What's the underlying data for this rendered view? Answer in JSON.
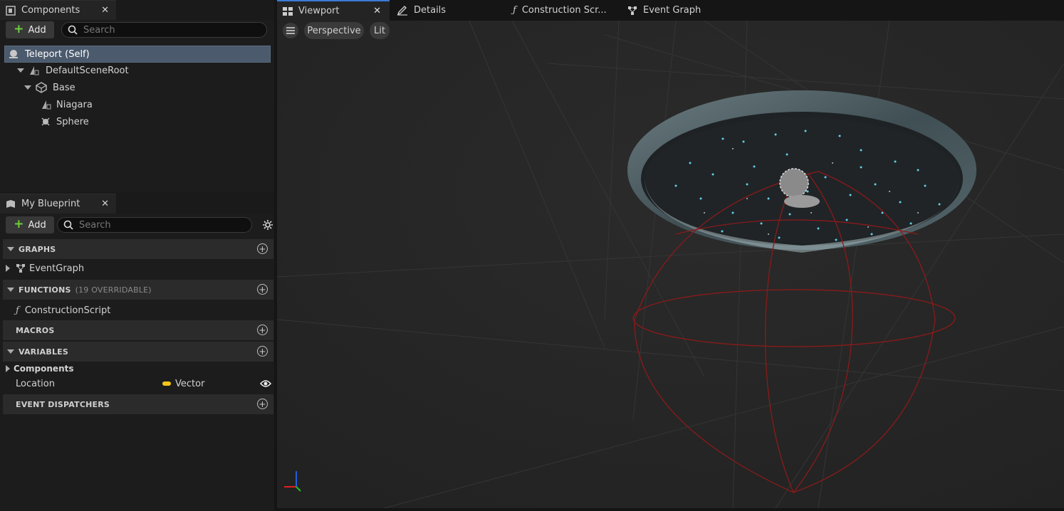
{
  "components_panel": {
    "tab_title": "Components",
    "add_label": "Add",
    "search_placeholder": "Search",
    "tree": [
      {
        "label": "Teleport (Self)"
      },
      {
        "label": "DefaultSceneRoot"
      },
      {
        "label": "Base"
      },
      {
        "label": "Niagara"
      },
      {
        "label": "Sphere"
      }
    ]
  },
  "blueprint_panel": {
    "tab_title": "My Blueprint",
    "add_label": "Add",
    "search_placeholder": "Search",
    "sections": {
      "graphs": "GRAPHS",
      "functions": "FUNCTIONS",
      "functions_sub": "(19 OVERRIDABLE)",
      "macros": "MACROS",
      "variables": "VARIABLES",
      "dispatchers": "EVENT DISPATCHERS"
    },
    "graphs_items": [
      "EventGraph"
    ],
    "functions_items": [
      "ConstructionScript"
    ],
    "variables_group": "Components",
    "variable": {
      "name": "Location",
      "type": "Vector",
      "type_color": "#f5c518"
    }
  },
  "editor_tabs": [
    "Viewport",
    "Details",
    "Construction Scr...",
    "Event Graph"
  ],
  "viewport": {
    "perspective_label": "Perspective",
    "lit_label": "Lit",
    "menu_icon": "hamburger-icon",
    "collision_color": "#8b1a1a"
  }
}
